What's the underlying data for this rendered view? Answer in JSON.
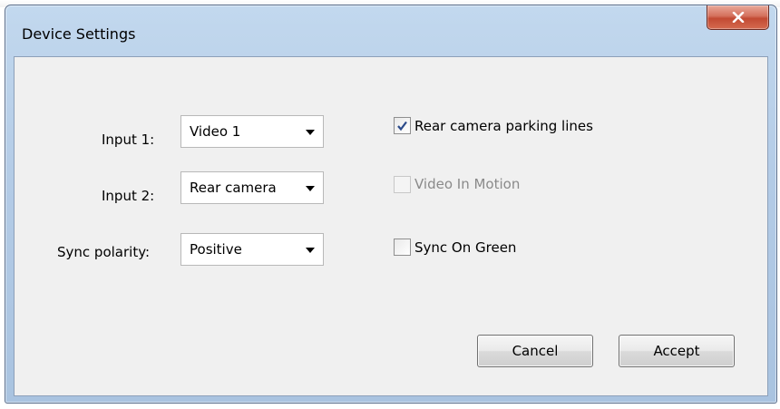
{
  "window": {
    "title": "Device Settings",
    "close_glyph": "x"
  },
  "form": {
    "input1": {
      "label": "Input 1:",
      "value": "Video 1"
    },
    "input2": {
      "label": "Input 2:",
      "value": "Rear camera"
    },
    "sync_polarity": {
      "label": "Sync polarity:",
      "value": "Positive"
    }
  },
  "options": {
    "rear_camera_parking_lines": {
      "label": "Rear camera parking lines",
      "checked": true,
      "enabled": true
    },
    "video_in_motion": {
      "label": "Video In Motion",
      "checked": false,
      "enabled": false
    },
    "sync_on_green": {
      "label": "Sync On Green",
      "checked": false,
      "enabled": true
    }
  },
  "buttons": {
    "cancel": "Cancel",
    "accept": "Accept"
  },
  "icons": {
    "close": "close-icon",
    "dropdown": "chevron-down-icon",
    "check": "checkmark-icon"
  },
  "colors": {
    "frame": "#b3cbe6",
    "client": "#f0f0f0",
    "close_button": "#c24a33",
    "check_mark": "#2b4a8a",
    "disabled_text": "#8a8a8a"
  }
}
